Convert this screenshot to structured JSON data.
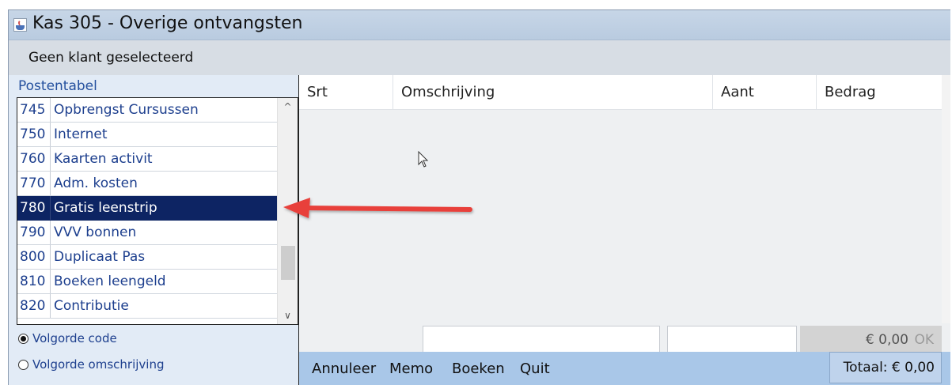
{
  "window": {
    "title": "Kas 305 - Overige ontvangsten",
    "icon": "java-cup-icon"
  },
  "customer_bar": {
    "text": "Geen klant geselecteerd"
  },
  "postentabel": {
    "header": "Postentabel",
    "items": [
      {
        "code": "745",
        "label": "Opbrengst Cursussen"
      },
      {
        "code": "750",
        "label": "Internet"
      },
      {
        "code": "760",
        "label": "Kaarten activit"
      },
      {
        "code": "770",
        "label": "Adm. kosten"
      },
      {
        "code": "780",
        "label": "Gratis leenstrip"
      },
      {
        "code": "790",
        "label": "VVV bonnen"
      },
      {
        "code": "800",
        "label": "Duplicaat Pas"
      },
      {
        "code": "810",
        "label": "Boeken leengeld"
      },
      {
        "code": "820",
        "label": "Contributie"
      }
    ],
    "selected_index": 4
  },
  "sort_options": [
    {
      "label": "Volgorde code",
      "checked": true
    },
    {
      "label": "Volgorde omschrijving",
      "checked": false
    }
  ],
  "table": {
    "columns": [
      "Srt",
      "Omschrijving",
      "Aant",
      "Bedrag"
    ],
    "rows": []
  },
  "entry": {
    "amount": "€ 0,00",
    "ok_label": "OK"
  },
  "actions": [
    "Annuleer",
    "Memo",
    "Boeken",
    "Quit"
  ],
  "total": {
    "text": "Totaal: € 0,00"
  },
  "colors": {
    "selection": "#0d2463",
    "action_bar": "#a9c7e8",
    "annotation_arrow": "#e8403a"
  }
}
